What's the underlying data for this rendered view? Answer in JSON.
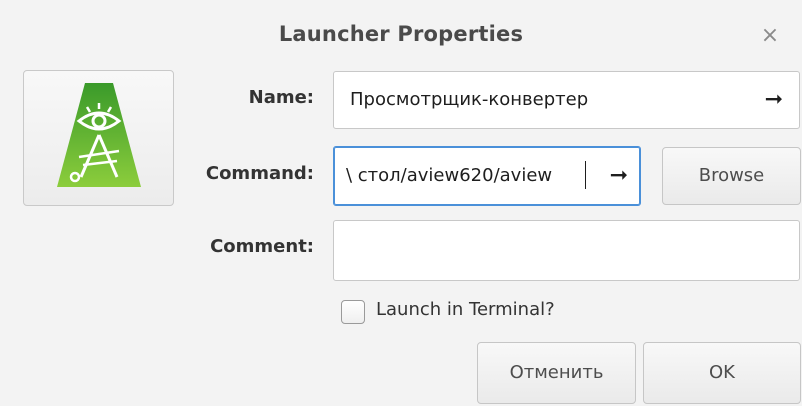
{
  "window": {
    "title": "Launcher Properties",
    "close_glyph": "×"
  },
  "icon": {
    "name": "app-icon",
    "colors": {
      "top": "#3a9a2a",
      "bottom": "#8ccd3c",
      "line": "#ffffff"
    }
  },
  "form": {
    "name_label": "Name:",
    "name_value": "Просмотрщик-конвертер",
    "command_label": "Command:",
    "command_value": "\\ стол/aview620/aview",
    "comment_label": "Comment:",
    "comment_value": "",
    "arrow_glyph": "➞",
    "terminal_label": "Launch in Terminal?",
    "terminal_checked": false
  },
  "buttons": {
    "browse": "Browse",
    "cancel": "Отменить",
    "ok": "OK"
  },
  "colors": {
    "focus": "#4a90d9",
    "background": "#f3f3f3"
  }
}
